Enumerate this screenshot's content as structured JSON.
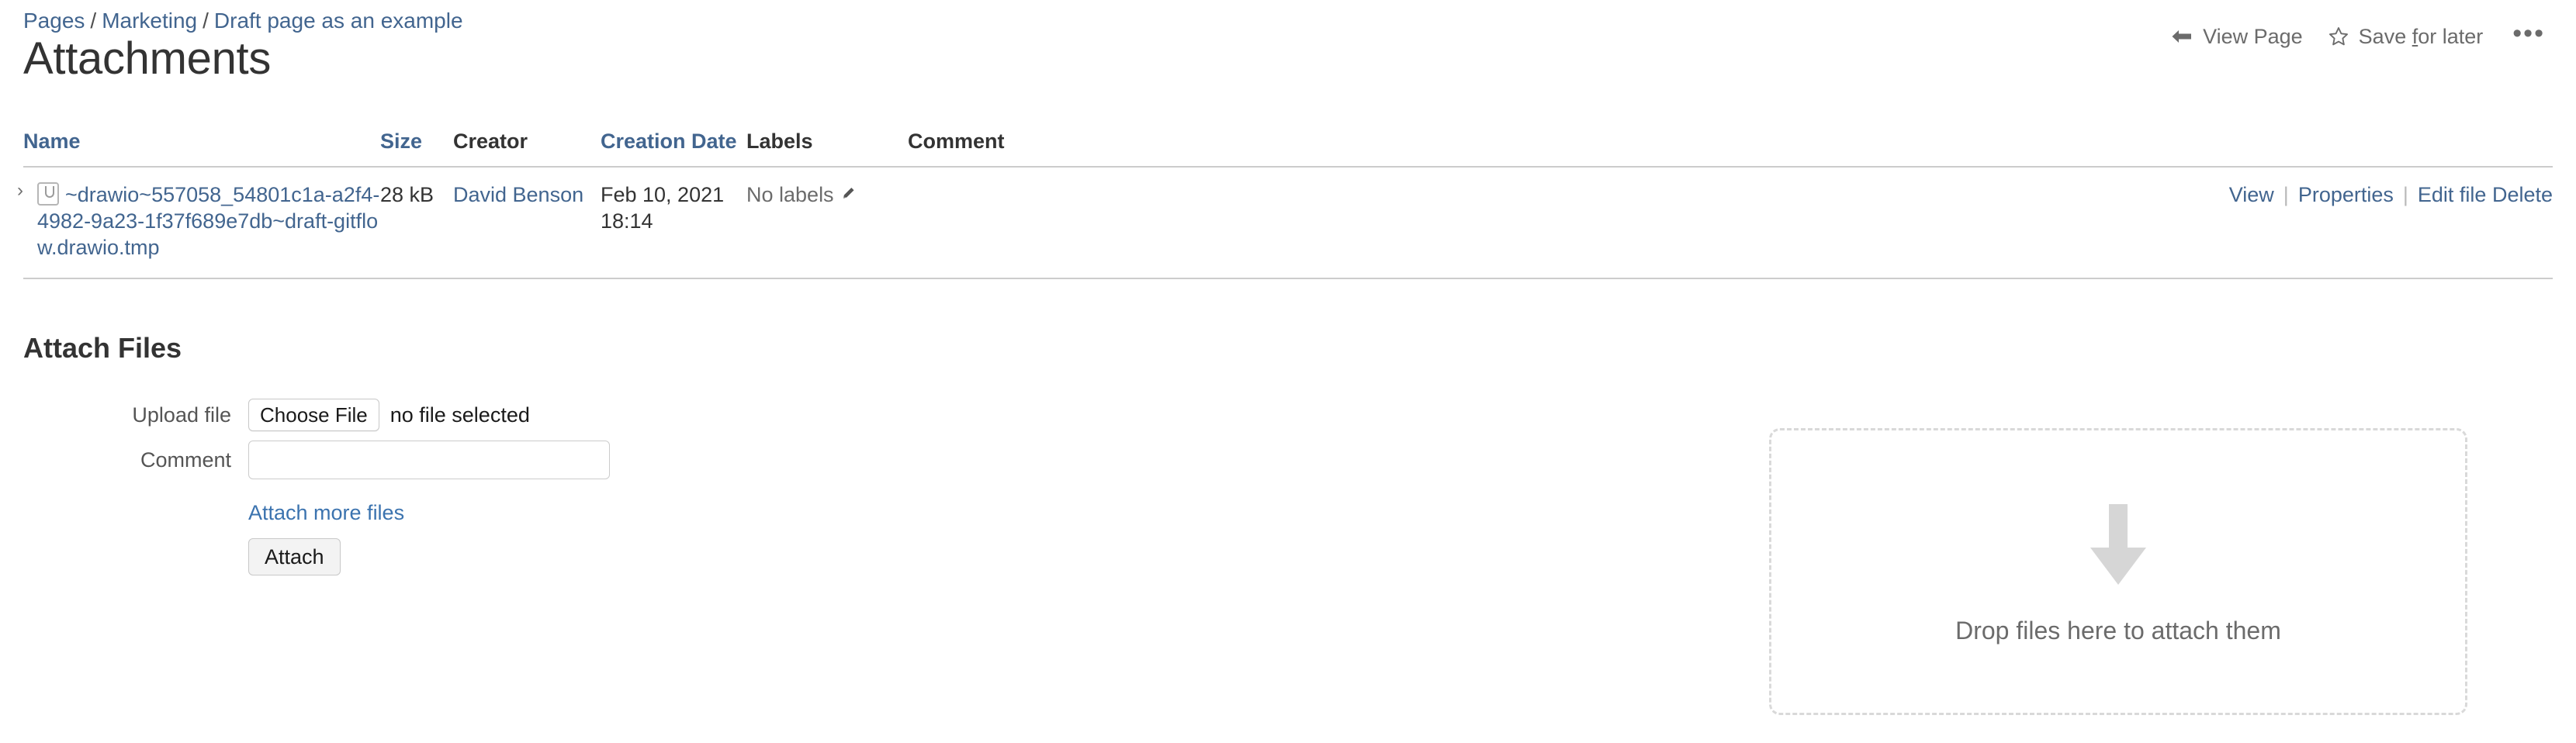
{
  "breadcrumb": {
    "items": [
      {
        "label": "Pages"
      },
      {
        "label": "Marketing"
      },
      {
        "label": "Draft page as an example"
      }
    ],
    "separator": "/"
  },
  "header": {
    "title": "Attachments",
    "actions": {
      "view_page_label": "View Page",
      "view_page_icon": "arrow-left-icon",
      "save_for_later_label": "Save for later",
      "save_for_later_icon": "star-icon",
      "more_label": "•••",
      "more_icon": "ellipsis-icon"
    }
  },
  "table": {
    "columns": [
      {
        "key": "name",
        "label": "Name",
        "link": true
      },
      {
        "key": "size",
        "label": "Size",
        "link": true
      },
      {
        "key": "creator",
        "label": "Creator",
        "link": false
      },
      {
        "key": "creation_date",
        "label": "Creation Date",
        "link": true
      },
      {
        "key": "labels",
        "label": "Labels",
        "link": false
      },
      {
        "key": "comment",
        "label": "Comment",
        "link": false
      }
    ],
    "rows": [
      {
        "expand_glyph": "›",
        "file_icon": "attachment-file-icon",
        "name": "~drawio~557058_54801c1a-a2f4-4982-9a23-1f37f689e7db~draft-gitflow.drawio.tmp",
        "size": "28 kB",
        "creator": "David Benson",
        "creation_date": "Feb 10, 2021 18:14",
        "labels": "No labels",
        "labels_edit_icon": "pencil-icon",
        "comment": "",
        "actions": {
          "view": "View",
          "properties": "Properties",
          "edit_file": "Edit file",
          "delete": "Delete",
          "divider": "|"
        }
      }
    ]
  },
  "attach_files": {
    "heading": "Attach Files",
    "upload_label": "Upload file",
    "choose_file_label": "Choose File",
    "no_file_selected": "no file selected",
    "comment_label": "Comment",
    "comment_value": "",
    "comment_placeholder": "",
    "attach_more_label": "Attach more files",
    "attach_button_label": "Attach"
  },
  "dropzone": {
    "text": "Drop files here to attach them",
    "icon": "down-arrow-icon"
  },
  "colors": {
    "link": "#42658f",
    "link_bright": "#3b73af",
    "text": "#333333",
    "muted": "#6b6b6b",
    "border": "#cccccc",
    "dropzone_border": "#d9d9d9",
    "dropzone_arrow": "#d6d6d6"
  }
}
